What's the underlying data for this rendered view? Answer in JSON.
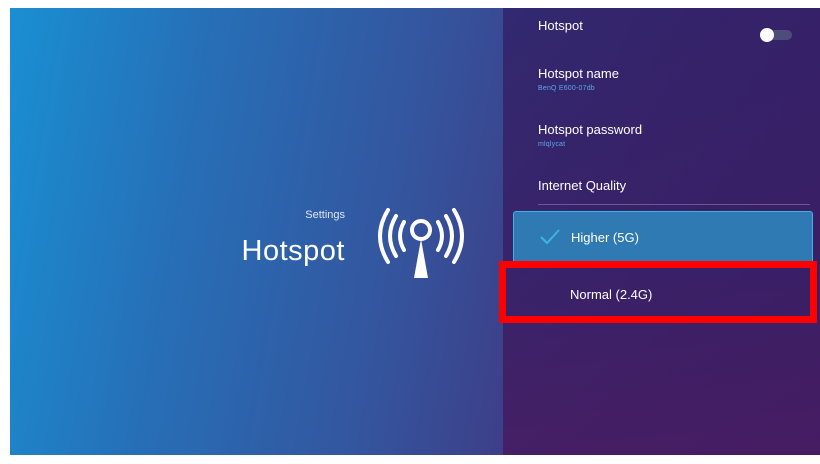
{
  "header": {
    "section_label": "Settings",
    "page_title": "Hotspot",
    "icon": "hotspot-broadcast-icon"
  },
  "settings": {
    "hotspot": {
      "label": "Hotspot",
      "enabled": false
    },
    "hotspot_name": {
      "label": "Hotspot name",
      "value": "BenQ E600-07db"
    },
    "hotspot_password": {
      "label": "Hotspot password",
      "value": "mlqlycat"
    },
    "internet_quality": {
      "label": "Internet Quality",
      "options": [
        {
          "label": "Higher (5G)",
          "selected": true
        },
        {
          "label": "Normal (2.4G)",
          "selected": false
        }
      ]
    }
  },
  "colors": {
    "accent": "#3fb2e6",
    "selected_bg": "#2f7ab2",
    "link_text": "#5aa7e6",
    "highlight": "#ff0000"
  }
}
